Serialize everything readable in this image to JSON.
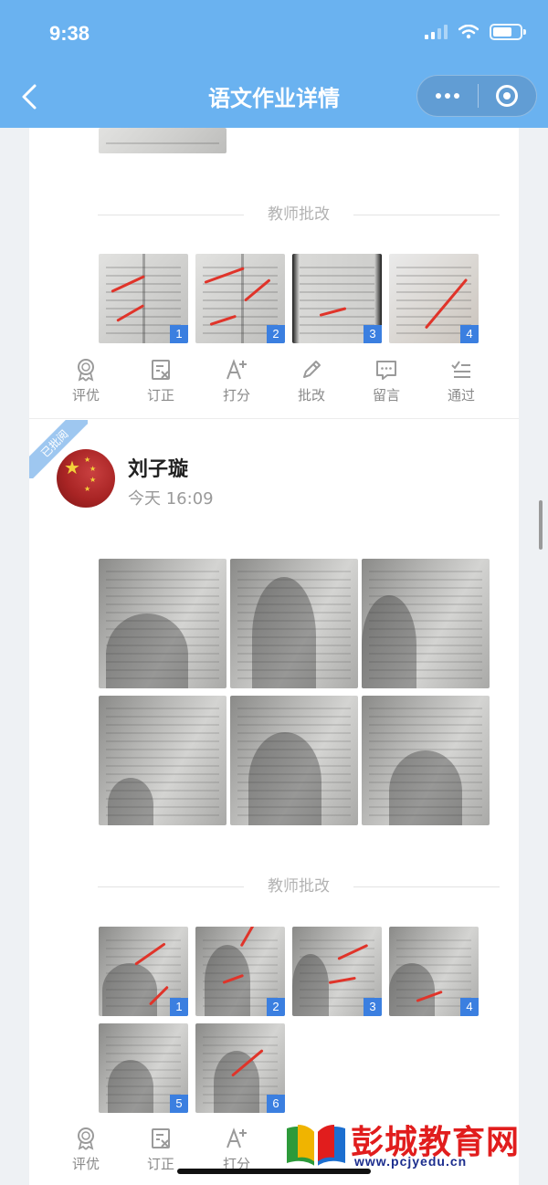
{
  "status_bar": {
    "time": "9:38"
  },
  "nav": {
    "title": "语文作业详情"
  },
  "section_divider": "教师批改",
  "first_entry": {
    "corrected_badges": [
      "1",
      "2",
      "3",
      "4"
    ]
  },
  "actions": [
    {
      "label": "评优",
      "icon": "award-icon"
    },
    {
      "label": "订正",
      "icon": "correction-icon"
    },
    {
      "label": "打分",
      "icon": "score-icon"
    },
    {
      "label": "批改",
      "icon": "pencil-icon"
    },
    {
      "label": "留言",
      "icon": "message-icon"
    },
    {
      "label": "通过",
      "icon": "pass-icon"
    }
  ],
  "second_entry": {
    "ribbon": "已批阅",
    "student_name": "刘子璇",
    "submit_time": "今天 16:09",
    "corrected_badges": [
      "1",
      "2",
      "3",
      "4",
      "5",
      "6"
    ]
  },
  "watermark": {
    "title": "彭城教育网",
    "url": "www.pcjyedu.cn"
  }
}
